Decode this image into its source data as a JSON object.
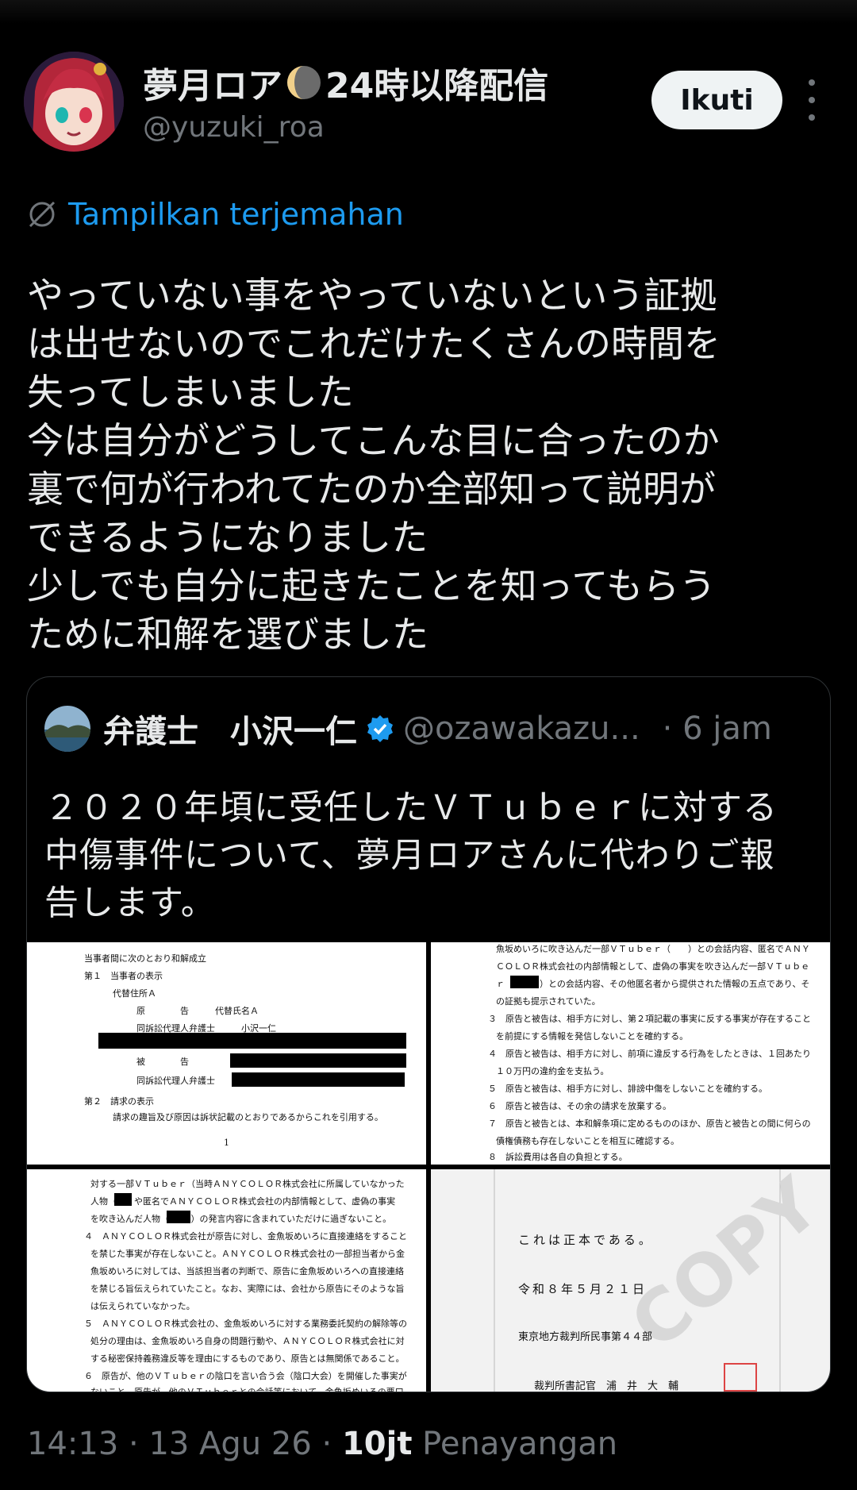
{
  "tweet": {
    "author_name_prefix": "夢月ロア",
    "author_name_suffix": "24時以降配信",
    "author_handle": "@yuzuki_roa",
    "follow_label": "Ikuti",
    "translate_label": "Tampilkan terjemahan",
    "body_lines": [
      "やっていない事をやっていないという証拠",
      "は出せないのでこれだけたくさんの時間を",
      "失ってしまいました",
      "今は自分がどうしてこんな目に合ったのか",
      "裏で何が行われてたのか全部知って説明が",
      "できるようになりました",
      "少しでも自分に起きたことを知ってもらう",
      "ために和解を選びました"
    ]
  },
  "quoted": {
    "name": "弁護士　小沢一仁",
    "handle": "@ozawakazu...",
    "time": "· 6 jam",
    "text_lines": [
      "２０２０年頃に受任したＶＴｕｂｅｒに対する",
      "中傷事件について、夢月ロアさんに代わりご報",
      "告します。"
    ],
    "doc1_lines": [
      "当事者間に次のとおり和解成立",
      "第１　当事者の表示",
      "代替住所Ａ",
      "原　　　　告　　　代替氏名Ａ",
      "同訴訟代理人弁護士　　　小沢一仁",
      "被　　　　告",
      "同訴訟代理人弁護士",
      "第２　請求の表示",
      "請求の趣旨及び原因は訴状記載のとおりであるからこれを引用する。",
      "1"
    ],
    "doc2_lines": [
      "魚坂めいろに吹き込んだ一部ＶＴｕｂｅｒ（　　）との会話内容、匿名でＡＮＹ",
      "ＣＯＬＯＲ株式会社の内部情報として、虚偽の事実を吹き込んだ一部ＶＴｕｂｅ",
      "ｒ（　　　）との会話内容、その他匿名者から提供された情報の五点であり、そ",
      "の証拠も提示されていた。",
      "３　原告と被告は、相手方に対し、第２項記載の事実に反する事実が存在すること",
      "を前提にする情報を発信しないことを確約する。",
      "４　原告と被告は、相手方に対し、前項に違反する行為をしたときは、１回あたり",
      "１０万円の違約金を支払う。",
      "５　原告と被告は、相手方に対し、誹謗中傷をしないことを確約する。",
      "６　原告と被告は、その余の請求を放棄する。",
      "７　原告と被告とは、本和解条項に定めるもののほか、原告と被告との間に何らの",
      "債権債務も存在しないことを相互に確認する。",
      "８　訴訟費用は各自の負担とする。"
    ],
    "doc3_lines": [
      "対する一部ＶＴｕｂｅｒ（当時ＡＮＹＣＯＬＯＲ株式会社に所属していなかった",
      "人物（　）や匿名でＡＮＹＣＯＬＯＲ株式会社の内部情報として、虚偽の事実",
      "を吹き込んだ人物（　　））の発言内容に含まれていただけに過ぎないこと。",
      "４　ＡＮＹＣＯＬＯＲ株式会社が原告に対し、金魚坂めいろに直接連絡をすること",
      "を禁じた事実が存在しないこと。ＡＮＹＣＯＬＯＲ株式会社の一部担当者から金",
      "魚坂めいろに対しては、当該担当者の判断で、原告に金魚坂めいろへの直接連絡",
      "を禁じる旨伝えられていたこと。なお、実際には、会社から原告にそのような旨",
      "は伝えられていなかった。",
      "５　ＡＮＹＣＯＬＯＲ株式会社の、金魚坂めいろに対する業務委託契約の解除等の",
      "処分の理由は、金魚坂めいろ自身の問題行動や、ＡＮＹＣＯＬＯＲ株式会社に対",
      "する秘密保持義務違反等を理由にするものであり、原告とは無関係であること。",
      "６　原告が、他のＶＴｕｂｅｒの陰口を言い合う会（陰口大会）を開催した事実が",
      "ないこと。原告が、他のＶＴｕｂｅｒとの会話等において、金魚坂めいろの悪口"
    ],
    "doc4_lines": [
      "これは正本である。",
      "令和８年５月２１日",
      "東京地方裁判所民事第４４部",
      "裁判所書記官　浦　井　大　輔"
    ],
    "watermark": "COPY"
  },
  "footer": {
    "time": "14:13",
    "date": "13 Agu 26",
    "views_count": "10jt",
    "views_label": "Penayangan"
  }
}
